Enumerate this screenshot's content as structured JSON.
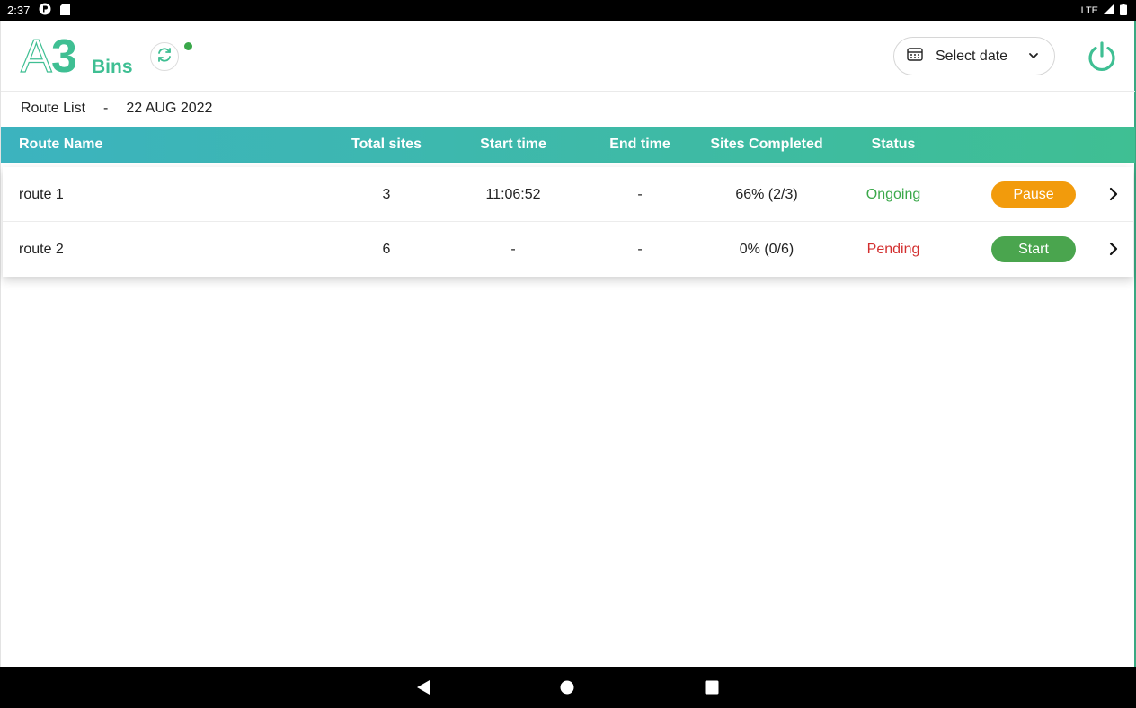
{
  "statusbar": {
    "time": "2:37",
    "network": "LTE"
  },
  "logo": {
    "a": "A",
    "three": "3",
    "bins": "Bins"
  },
  "header": {
    "date_select_label": "Select date"
  },
  "subheader": {
    "title": "Route List",
    "separator": "-",
    "date": "22 AUG 2022"
  },
  "table": {
    "columns": [
      "Route Name",
      "Total sites",
      "Start time",
      "End time",
      "Sites Completed",
      "Status"
    ],
    "rows": [
      {
        "name": "route 1",
        "total_sites": "3",
        "start_time": "11:06:52",
        "end_time": "-",
        "sites_completed": "66% (2/3)",
        "status": "Ongoing",
        "action": "Pause"
      },
      {
        "name": "route 2",
        "total_sites": "6",
        "start_time": "-",
        "end_time": "-",
        "sites_completed": "0% (0/6)",
        "status": "Pending",
        "action": "Start"
      }
    ]
  },
  "colors": {
    "brand": "#3fbf93",
    "header_gradient_start": "#3cb3bf",
    "ongoing": "#3aa84a",
    "pending": "#d32f2f",
    "pause": "#f29b0c",
    "start": "#4aa54e"
  },
  "icons": [
    "sync-icon",
    "calendar-icon",
    "chevron-down-icon",
    "power-icon",
    "chevron-right-icon",
    "back-icon",
    "home-icon",
    "recents-icon"
  ]
}
